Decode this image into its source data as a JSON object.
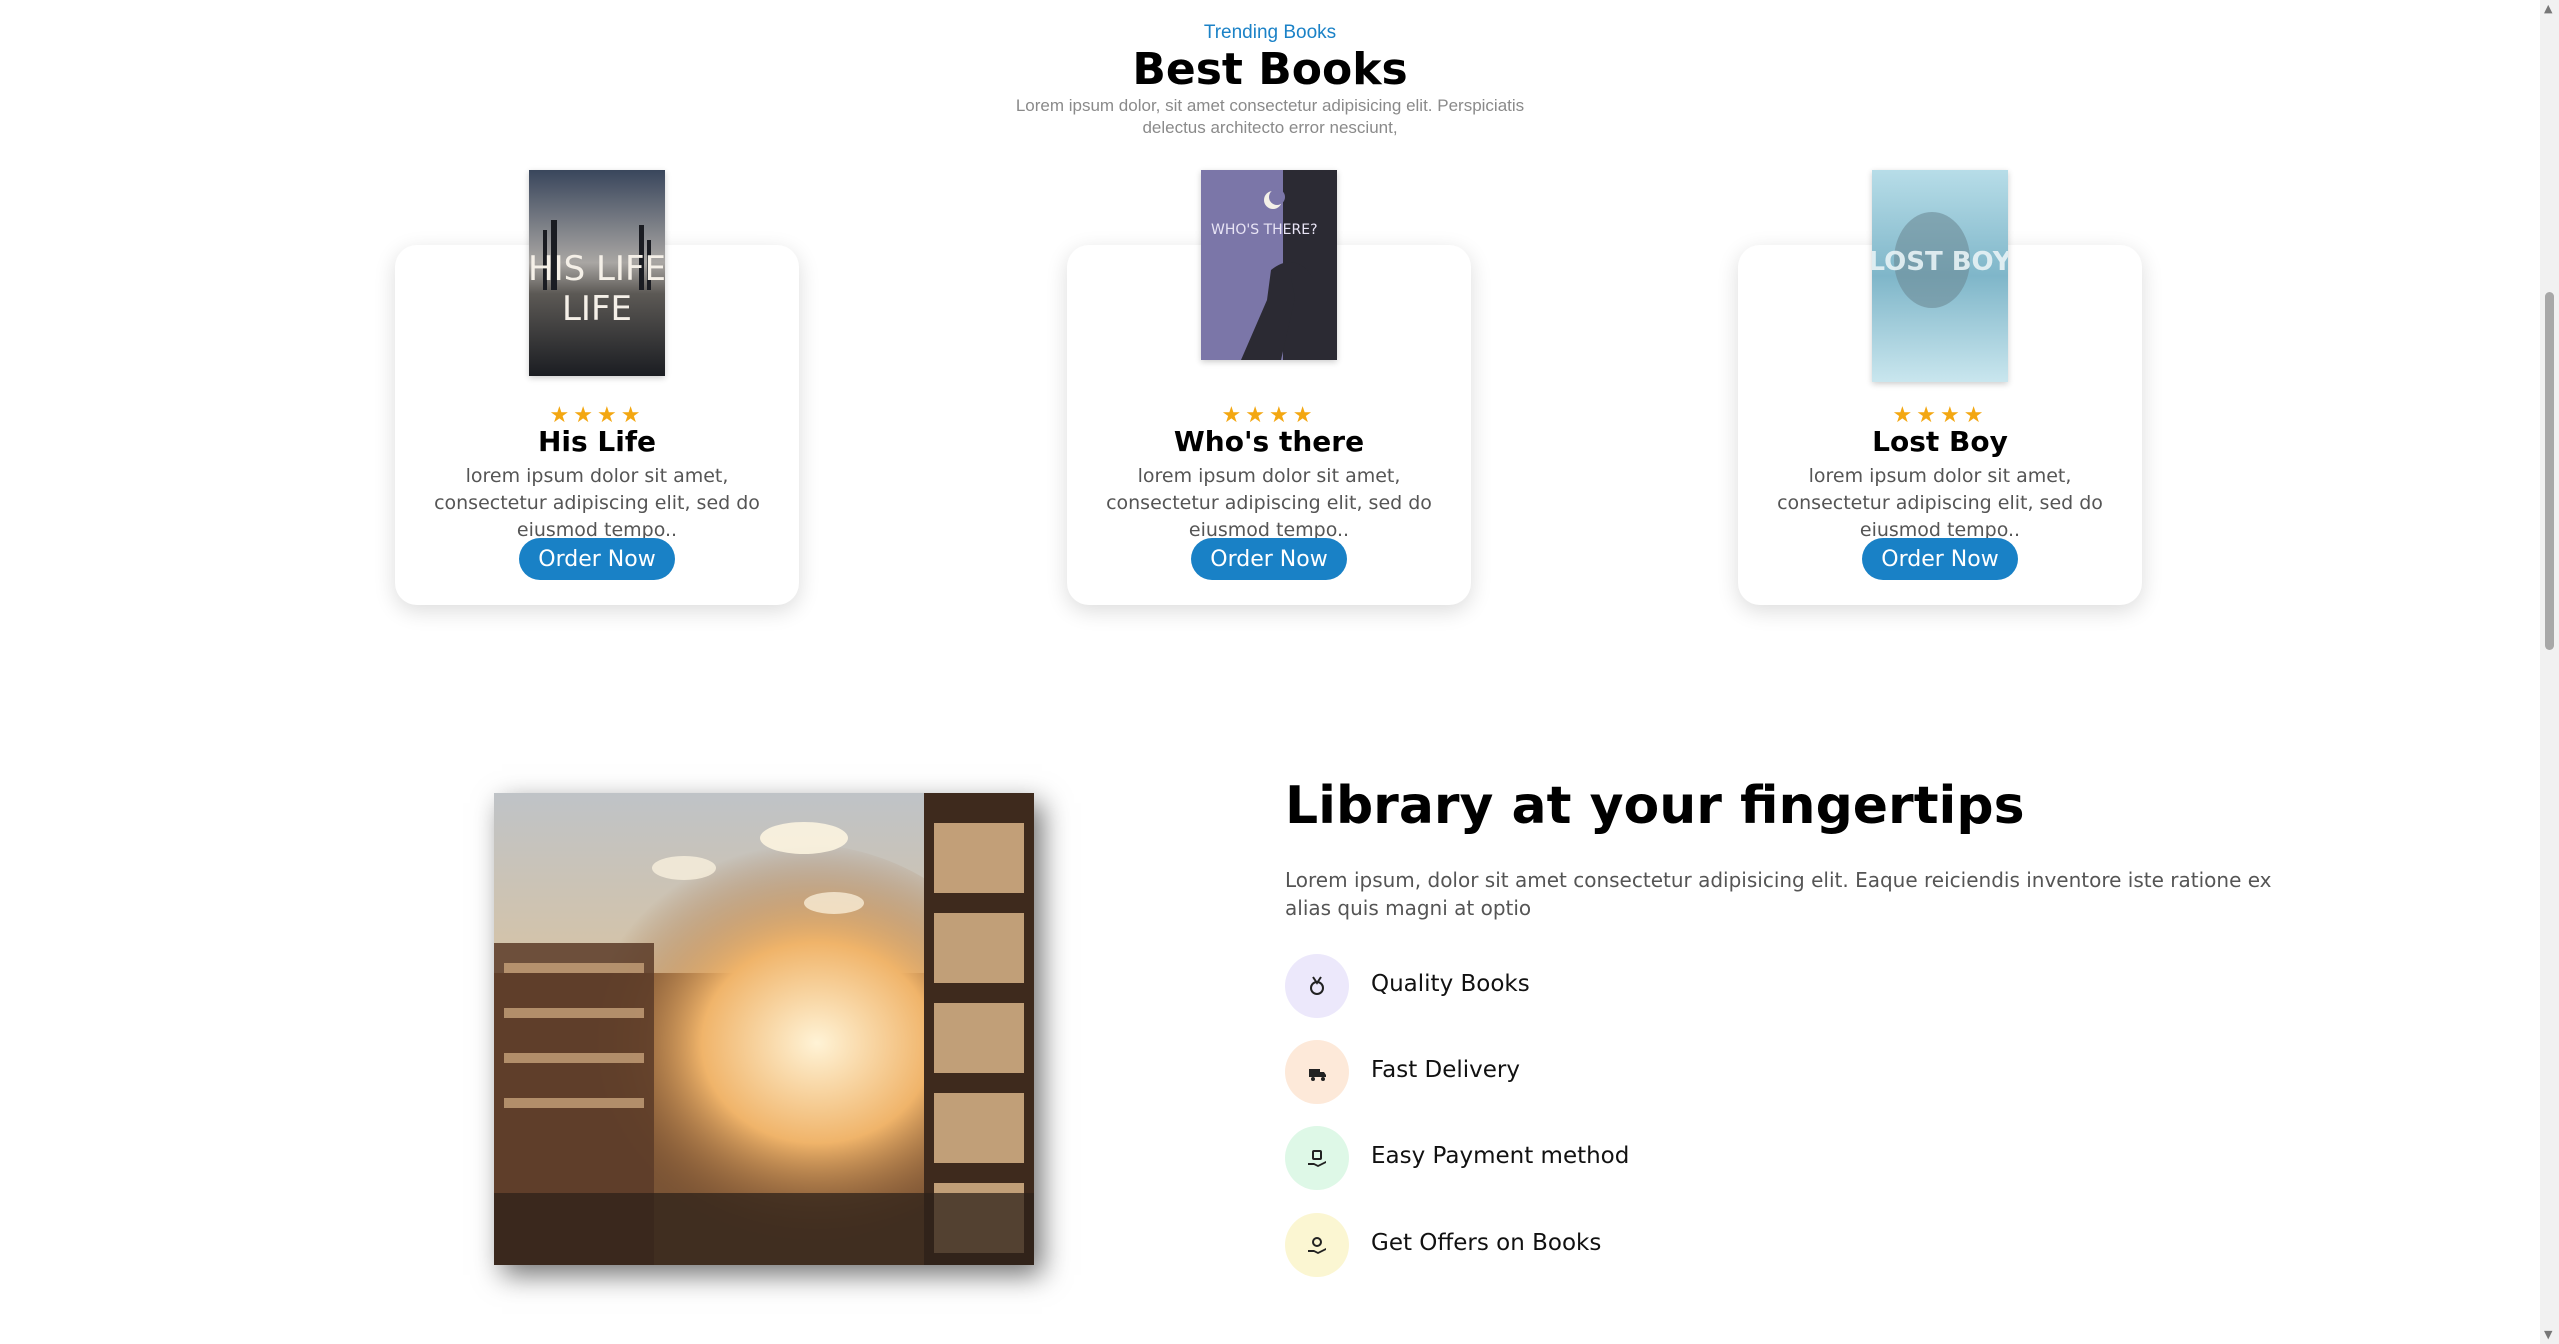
{
  "section": {
    "eyebrow": "Trending Books",
    "title": "Best Books",
    "subtitle": "Lorem ipsum dolor, sit amet consectetur adipisicing elit. Perspiciatis delectus architecto error nesciunt,"
  },
  "books": [
    {
      "stars": "★★★★",
      "rating": 4,
      "name": "His Life",
      "desc": "lorem ipsum dolor sit amet, consectetur adipiscing elit, sed do eiusmod tempo..",
      "button": "Order Now",
      "cover_text": "HIS LIFE"
    },
    {
      "stars": "★★★★",
      "rating": 4,
      "name": "Who's there",
      "desc": "lorem ipsum dolor sit amet, consectetur adipiscing elit, sed do eiusmod tempo..",
      "button": "Order Now",
      "cover_text": "WHO'S THERE?"
    },
    {
      "stars": "★★★★",
      "rating": 4,
      "name": "Lost Boy",
      "desc": "lorem ipsum dolor sit amet, consectetur adipiscing elit, sed do eiusmod tempo..",
      "button": "Order Now",
      "cover_text": "LOST BOY"
    }
  ],
  "library": {
    "title": "Library at your fingertips",
    "desc": "Lorem ipsum, dolor sit amet consectetur adipisicing elit. Eaque reiciendis inventore iste ratione ex alias quis magni at optio",
    "features": [
      {
        "label": "Quality Books",
        "icon": "medal-icon",
        "color": "#ece8fb"
      },
      {
        "label": "Fast Delivery",
        "icon": "delivery-icon",
        "color": "#fde9d9"
      },
      {
        "label": "Easy Payment method",
        "icon": "payment-icon",
        "color": "#def8e7"
      },
      {
        "label": "Get Offers on Books",
        "icon": "offer-icon",
        "color": "#fbf6d2"
      }
    ]
  },
  "colors": {
    "accent": "#1981c6",
    "star": "#f3a712"
  }
}
